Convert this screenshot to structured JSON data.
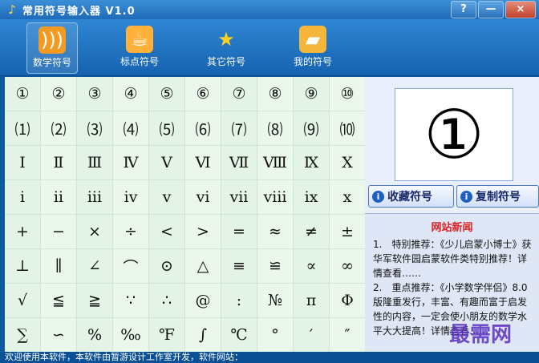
{
  "window": {
    "title": "常用符号输入器 V1.0",
    "help": "?",
    "minimize": "—",
    "close": "×"
  },
  "tabs": [
    {
      "label": "数学符号",
      "icon": "rss-icon"
    },
    {
      "label": "标点符号",
      "icon": "cup-icon"
    },
    {
      "label": "其它符号",
      "icon": "star-icon"
    },
    {
      "label": "我的符号",
      "icon": "folder-icon"
    }
  ],
  "symbols": [
    "①",
    "②",
    "③",
    "④",
    "⑤",
    "⑥",
    "⑦",
    "⑧",
    "⑨",
    "⑩",
    "⑴",
    "⑵",
    "⑶",
    "⑷",
    "⑸",
    "⑹",
    "⑺",
    "⑻",
    "⑼",
    "⑽",
    "Ⅰ",
    "Ⅱ",
    "Ⅲ",
    "Ⅳ",
    "Ⅴ",
    "Ⅵ",
    "Ⅶ",
    "Ⅷ",
    "Ⅸ",
    "Ⅹ",
    "ⅰ",
    "ⅱ",
    "ⅲ",
    "ⅳ",
    "ⅴ",
    "ⅵ",
    "ⅶ",
    "ⅷ",
    "ⅸ",
    "ⅹ",
    "+",
    "−",
    "×",
    "÷",
    "<",
    ">",
    "=",
    "≈",
    "≠",
    "±",
    "⊥",
    "∥",
    "∠",
    "⌒",
    "⊙",
    "△",
    "≡",
    "≌",
    "∝",
    "∞",
    "√",
    "≦",
    "≧",
    "∵",
    "∴",
    "@",
    ":",
    "№",
    "π",
    "Φ",
    "∑",
    "∽",
    "%",
    "‰",
    "℉",
    "∫",
    "℃",
    "°",
    "′",
    "″"
  ],
  "preview": "①",
  "buttons": {
    "favorite": "收藏符号",
    "copy": "复制符号"
  },
  "news": {
    "title": "网站新闻",
    "item1": "1.　特别推荐：《少儿启蒙小博士》获华军软件园启蒙软件类特别推荐！详情查看……",
    "item2": "2.　重点推荐：《小学数学伴侣》8.0版隆重发行，丰富、有趣而富于启发性的内容，一定会使小朋友的数学水平大大提高！详情查看……"
  },
  "status": "欢迎使用本软件，本软件由暂游设计工作室开发，软件网站：",
  "watermark": "最需网"
}
